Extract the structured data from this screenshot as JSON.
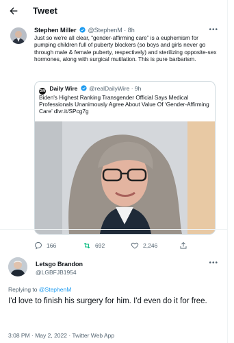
{
  "header": {
    "title": "Tweet"
  },
  "tweet": {
    "author_name": "Stephen Miller",
    "author_handle": "@StephenM",
    "time": "· 8h",
    "text": "Just so we're all clear, “gender-affirming care” is a euphemism for pumping children full of puberty blockers (so boys and girls never go through male & female puberty, respectively) and sterilizing opposite-sex hormones, along with surgical mutilation. This is pure barbarism.",
    "quote": {
      "badge": "DW",
      "author_name": "Daily Wire",
      "author_handle": "@realDailyWire",
      "time": "· 9h",
      "text": "Biden's Highest Ranking Transgender Official Says Medical Professionals Unanimously Agree About Value Of ‘Gender-Affirming Care’ dlvr.it/SPcg7g"
    },
    "actions": {
      "replies": "166",
      "retweets": "692",
      "likes": "2,246"
    }
  },
  "reply": {
    "author_name": "Letsgo Brandon",
    "author_handle": "@LGBFJB1954",
    "replying_prefix": "Replying to",
    "replying_handle": "@StephenM",
    "text": "I'd love to finish his surgery for him. I'd even do it for free.",
    "timestamp": "3:08 PM · May 2, 2022 · Twitter Web App"
  },
  "colors": {
    "accent": "#1d9bf0",
    "retweet": "#00ba7c",
    "text": "#0f1419",
    "muted": "#536471"
  }
}
